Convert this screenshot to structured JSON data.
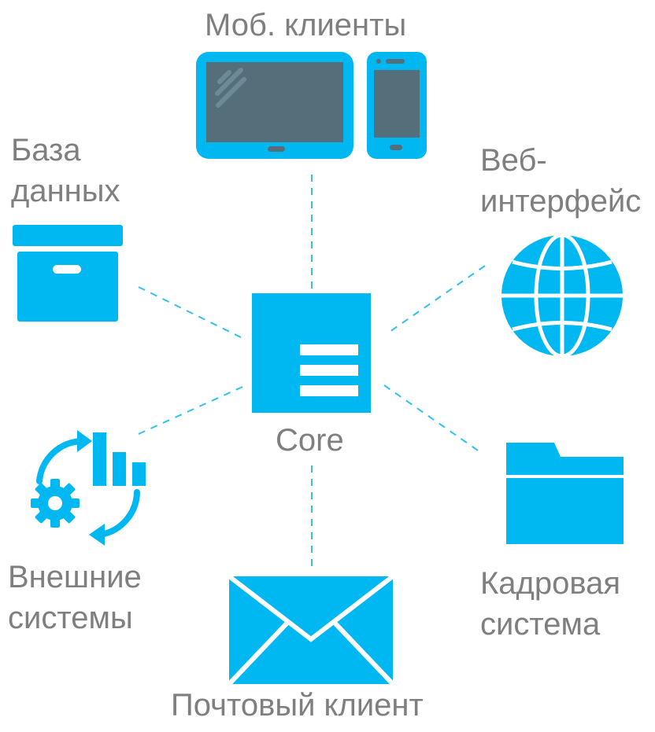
{
  "colors": {
    "accent": "#00b8f1",
    "screen": "#546e7a",
    "label": "#7f7f7f",
    "connector": "#33bff0"
  },
  "nodes": {
    "mobile": {
      "label": "Моб. клиенты",
      "icons": [
        "tablet-icon",
        "phone-icon"
      ]
    },
    "database": {
      "label_line1": "База",
      "label_line2": "данных",
      "icon": "archive-box-icon"
    },
    "web": {
      "label_line1": "Веб-",
      "label_line2": "интерфейс",
      "icon": "globe-icon"
    },
    "core": {
      "label": "Core",
      "icon": "document-icon"
    },
    "external": {
      "label_line1": "Внешние",
      "label_line2": "системы",
      "icon": "sync-chart-gear-icon"
    },
    "hr": {
      "label_line1": "Кадровая",
      "label_line2": "система",
      "icon": "folder-icon"
    },
    "mail": {
      "label": "Почтовый клиент",
      "icon": "envelope-icon"
    }
  }
}
